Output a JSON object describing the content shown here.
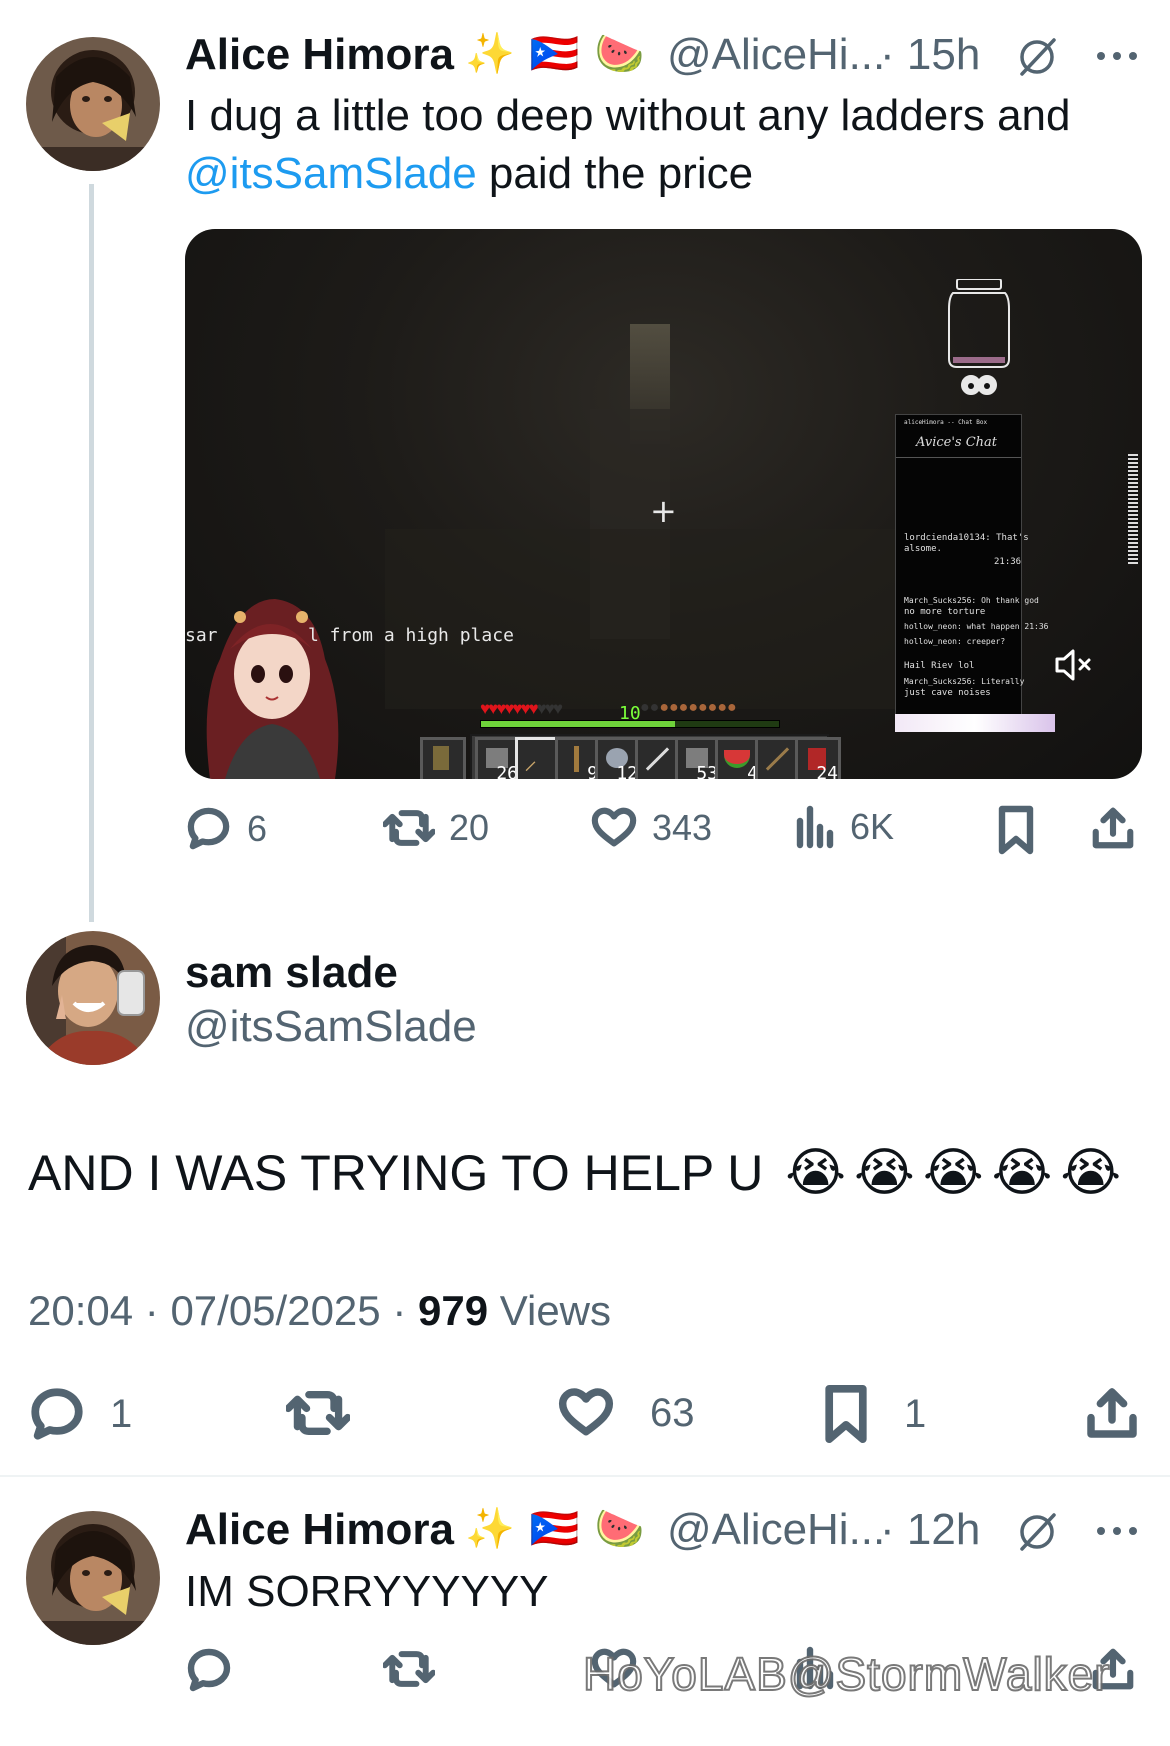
{
  "tweet1": {
    "name": "Alice Himora",
    "badges": "✨ 🇵🇷 🍉",
    "handle": "@AliceHi...",
    "time": "· 15h",
    "text_part1": "I dug a little too deep without any ladders and",
    "mention": "@itsSamSlade",
    "text_part2": " paid the price",
    "replies": "6",
    "reposts": "20",
    "likes": "343",
    "views": "6K"
  },
  "game_overlay": {
    "death_message_prefix": "sar",
    "death_message": "l from a high place",
    "level": "10",
    "hotbar_counts": [
      "26",
      "9",
      "12",
      "53",
      "4",
      "24"
    ],
    "chat_header": "Avice's Chat",
    "chat_box_label": "aliceHimora -- Chat Box",
    "chat_lines": [
      "lordcienda10134: That's",
      "alsome.",
      "21:36",
      "March_Sucks256: Oh thank god",
      "no more torture",
      "hollow_neon: what happen 21:36",
      "hollow_neon: creeper?",
      "Hail Riev lol",
      "March_Sucks256: Literally",
      "just cave noises"
    ]
  },
  "tweet2": {
    "name": "sam slade",
    "handle": "@itsSamSlade",
    "text": "AND I WAS TRYING TO HELP U",
    "emojis": "😭😭😭😭😭",
    "time": "20:04",
    "date": "07/05/2025",
    "views_count": "979",
    "views_label": "Views",
    "replies": "1",
    "likes": "63",
    "bookmarks": "1"
  },
  "tweet3": {
    "name": "Alice Himora",
    "badges": "✨ 🇵🇷 🍉",
    "handle": "@AliceHi...",
    "time": "· 12h",
    "text": "IM SORRYYYYYY"
  },
  "watermark": "HoYoLAB@StormWalker",
  "colors": {
    "link": "#1d9bf0",
    "secondary": "#536471",
    "divider": "#eff3f4",
    "thread_line": "#cfd9de"
  }
}
